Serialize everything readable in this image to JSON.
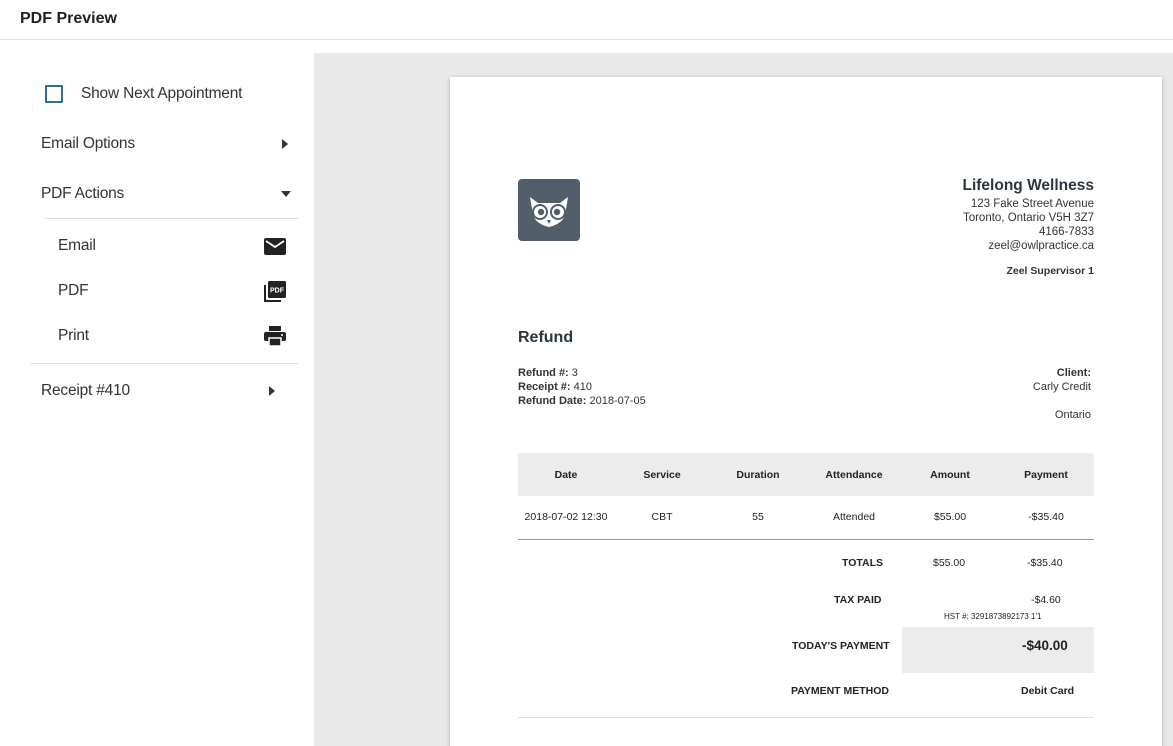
{
  "header": {
    "title": "PDF Preview"
  },
  "sidebar": {
    "show_next_appointment": {
      "label": "Show Next Appointment",
      "checked": false
    },
    "email_options": {
      "label": "Email Options",
      "icon": "chevron-right-icon"
    },
    "pdf_actions": {
      "label": "PDF Actions",
      "icon": "chevron-down-icon",
      "items": [
        {
          "label": "Email",
          "icon": "mail-icon"
        },
        {
          "label": "PDF",
          "icon": "pdf-icon"
        },
        {
          "label": "Print",
          "icon": "printer-icon"
        }
      ]
    },
    "receipt": {
      "label": "Receipt #410",
      "icon": "chevron-right-icon"
    }
  },
  "document": {
    "logo_icon": "owl-logo-icon",
    "company": {
      "name": "Lifelong Wellness",
      "address1": "123 Fake Street Avenue",
      "address2": "Toronto, Ontario  V5H 3Z7",
      "phone": "4166-7833",
      "email": "zeel@owlpractice.ca",
      "supervisor": "Zeel Supervisor 1"
    },
    "title": "Refund",
    "meta": {
      "refund_label": "Refund #:",
      "refund_value": "3",
      "receipt_label": "Receipt #:",
      "receipt_value": "410",
      "date_label": "Refund Date:",
      "date_value": "2018-07-05"
    },
    "client": {
      "label": "Client:",
      "name": "Carly Credit",
      "region": "Ontario"
    },
    "table": {
      "headers": [
        "Date",
        "Service",
        "Duration",
        "Attendance",
        "Amount",
        "Payment"
      ],
      "rows": [
        [
          "2018-07-02 12:30",
          "CBT",
          "55",
          "Attended",
          "$55.00",
          "-$35.40"
        ]
      ]
    },
    "totals": {
      "totals_label": "TOTALS",
      "totals_amount": "$55.00",
      "totals_payment": "-$35.40",
      "tax_label": "TAX PAID",
      "tax_value": "-$4.60",
      "hst": "HST #: 3291873892173 1'1",
      "todays_label": "TODAY'S PAYMENT",
      "todays_value": "-$40.00",
      "method_label": "PAYMENT METHOD",
      "method_value": "Debit Card"
    }
  },
  "colors": {
    "checkbox_border": "#2c6f93",
    "logo_bg": "#525f6b",
    "preview_bg": "#e9e9e9",
    "table_header_bg": "#ececec"
  }
}
